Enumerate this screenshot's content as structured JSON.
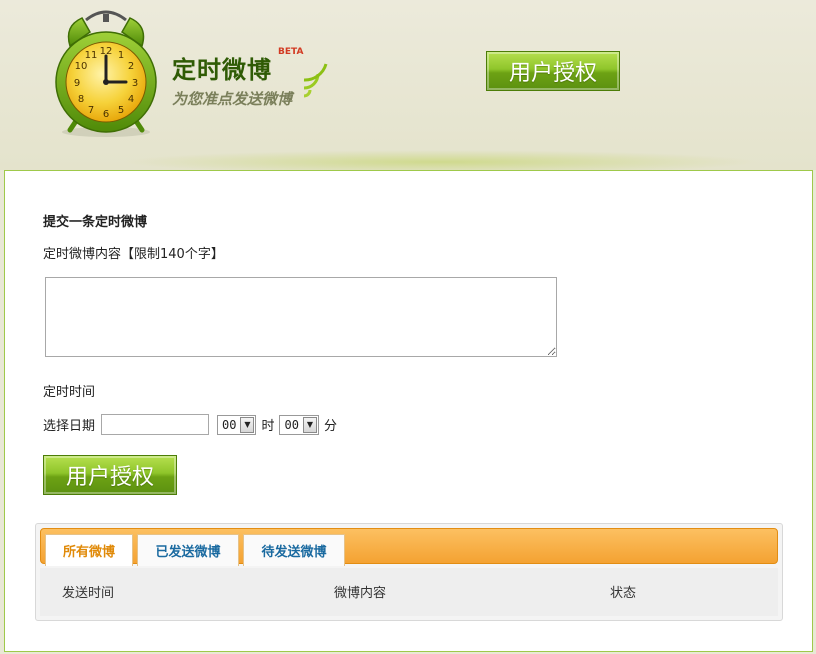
{
  "header": {
    "brand_title": "定时微博",
    "brand_beta": "BETA",
    "brand_tagline": "为您准点发送微博",
    "clock_icon": "alarm-clock-icon",
    "signal_icon": "signal-waves-icon",
    "auth_button_label": "用户授权"
  },
  "form": {
    "heading": "提交一条定时微博",
    "content_label": "定时微博内容【限制140个字】",
    "content_value": "",
    "time_label": "定时时间",
    "date_label": "选择日期",
    "date_value": "",
    "hour_value": "00",
    "hour_unit": "时",
    "minute_value": "00",
    "minute_unit": "分",
    "submit_label": "用户授权"
  },
  "tabs": [
    {
      "label": "所有微博",
      "active": true
    },
    {
      "label": "已发送微博",
      "active": false
    },
    {
      "label": "待发送微博",
      "active": false
    }
  ],
  "table": {
    "columns": [
      "发送时间",
      "微博内容",
      "状态"
    ]
  },
  "colors": {
    "accent_green": "#6da214",
    "tab_orange": "#f4a232",
    "active_tab_text": "#e08a09",
    "tab_text": "#1a6aa0"
  }
}
